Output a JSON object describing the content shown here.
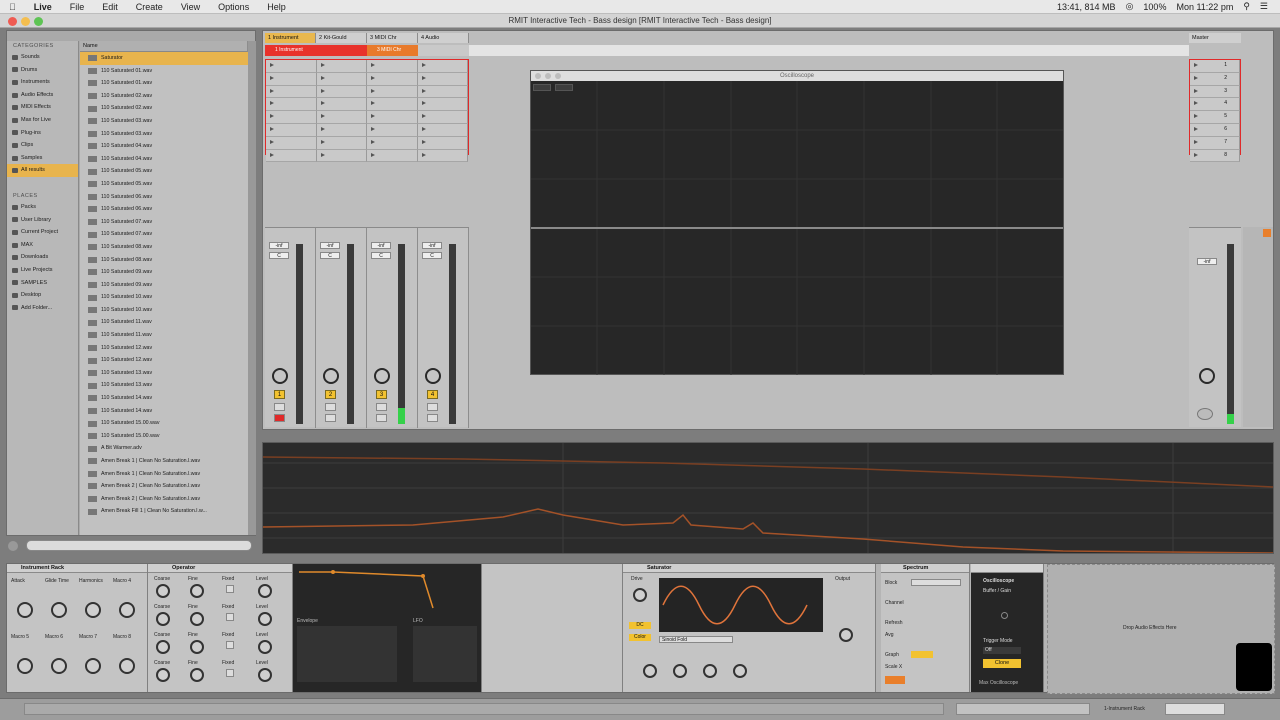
{
  "menubar": {
    "items": [
      "Live",
      "File",
      "Edit",
      "Create",
      "View",
      "Options",
      "Help"
    ],
    "status": [
      "13:41, 814 MB",
      "100%",
      "Mon 11:22 pm"
    ]
  },
  "window_title": "RMIT Interactive Tech - Bass design  [RMIT Interactive Tech - Bass design]",
  "browser": {
    "categories_header": "CATEGORIES",
    "categories": [
      "Sounds",
      "Drums",
      "Instruments",
      "Audio Effects",
      "MIDI Effects",
      "Max for Live",
      "Plug-ins",
      "Clips",
      "Samples",
      "All results"
    ],
    "places_header": "PLACES",
    "places": [
      "Packs",
      "User Library",
      "Current Project",
      "MAX",
      "Downloads",
      "Live Projects",
      "SAMPLES",
      "Desktop",
      "Add Folder..."
    ],
    "name_header": "Name",
    "files": [
      "Saturator",
      "110 Saturated 01.wav",
      "110 Saturated 01.wav",
      "110 Saturated 02.wav",
      "110 Saturated 02.wav",
      "110 Saturated 03.wav",
      "110 Saturated 03.wav",
      "110 Saturated 04.wav",
      "110 Saturated 04.wav",
      "110 Saturated 05.wav",
      "110 Saturated 05.wav",
      "110 Saturated 06.wav",
      "110 Saturated 06.wav",
      "110 Saturated 07.wav",
      "110 Saturated 07.wav",
      "110 Saturated 08.wav",
      "110 Saturated 08.wav",
      "110 Saturated 09.wav",
      "110 Saturated 09.wav",
      "110 Saturated 10.wav",
      "110 Saturated 10.wav",
      "110 Saturated 11.wav",
      "110 Saturated 11.wav",
      "110 Saturated 12.wav",
      "110 Saturated 12.wav",
      "110 Saturated 13.wav",
      "110 Saturated 13.wav",
      "110 Saturated 14.wav",
      "110 Saturated 14.wav",
      "110 Saturated 15.00.wav",
      "110 Saturated 15.00.wav",
      "A Bit Warmer.adv",
      "Amen Break 1 | Clean No Saturation.l.wav",
      "Amen Break 1 | Clean No Saturation.l.wav",
      "Amen Break 2 | Clean No Saturation.l.wav",
      "Amen Break 2 | Clean No Saturation.l.wav",
      "Amen Break Fill 1 | Clean No Saturation.l.w..."
    ]
  },
  "tracks": [
    {
      "name": "1 Instrument",
      "color": "#e8322b",
      "clip": "1 Instrument",
      "num": "1",
      "vol": "-inf",
      "pan": "C"
    },
    {
      "name": "2 Kit-Gould",
      "color": "#e8322b",
      "clip": "",
      "num": "2",
      "vol": "-inf",
      "pan": "C"
    },
    {
      "name": "3 MIDI Chr",
      "color": "#e87a2b",
      "clip": "3 MIDI Chr",
      "num": "3",
      "vol": "-inf",
      "pan": "C"
    },
    {
      "name": "4 Audio",
      "color": "#bdbdbd",
      "clip": "",
      "num": "4",
      "vol": "-inf",
      "pan": "C"
    }
  ],
  "master": {
    "name": "Master",
    "scenes": [
      "1",
      "2",
      "3",
      "4",
      "5",
      "6",
      "7",
      "8"
    ],
    "vol": "-inf"
  },
  "oscilloscope_window": {
    "title": "Oscilloscope"
  },
  "devices": {
    "instrument_rack": {
      "title": "Instrument Rack",
      "macros": [
        "Attack",
        "Glide Time",
        "Harmonics",
        "Macro 4",
        "Macro 5",
        "Macro 6",
        "Macro 7",
        "Macro 8"
      ]
    },
    "operator": {
      "title": "Operator",
      "labels": [
        "Coarse",
        "Fine",
        "Fixed",
        "Level"
      ],
      "lfo": "LFO",
      "envelope": "Envelope"
    },
    "saturator": {
      "title": "Saturator",
      "drive": "Drive",
      "output": "Output",
      "shape": "Sinoid Fold",
      "buttons": [
        "DC",
        "Color"
      ]
    },
    "spectrum": {
      "title": "Spectrum",
      "labels": [
        "Block",
        "Channel",
        "Refresh",
        "Avg",
        "Graph",
        "Scale X"
      ]
    },
    "oscilloscope": {
      "title": "Oscilloscope",
      "subtitle": "Buffer / Gain",
      "trigger_mode": "Trigger Mode",
      "trigger_value": "Off",
      "button": "Clone",
      "footer": "Max Oscilloscope"
    },
    "drop_hint": "Drop Audio Effects Here"
  },
  "statusbar": {
    "right": "1-Instrument Rack"
  }
}
